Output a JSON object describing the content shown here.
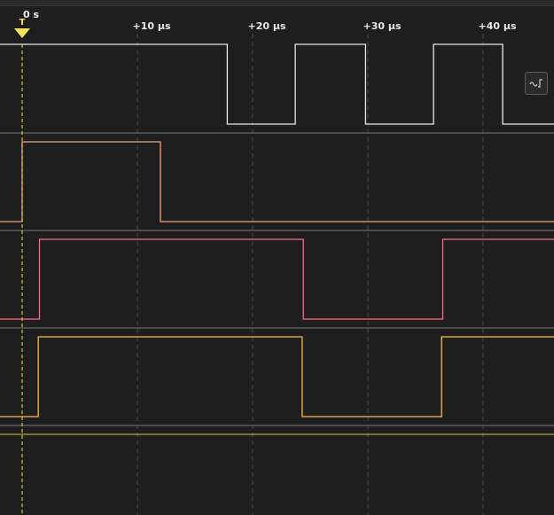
{
  "timeline": {
    "zero_label": "0 s",
    "tick_labels": [
      "+10 µs",
      "+20 µs",
      "+30 µs",
      "+40 µs"
    ],
    "trigger_letter": "T"
  },
  "channels": [
    {
      "color": "#e8e8e8",
      "edges_us": [
        17.8,
        23.7,
        29.8,
        35.7,
        41.7
      ],
      "initial": "high"
    },
    {
      "color": "#f2a07a",
      "edges_us": [
        -0.0,
        12.0
      ],
      "initial": "low"
    },
    {
      "color": "#ff6b86",
      "edges_us": [
        1.5,
        24.4,
        36.5
      ],
      "initial": "low"
    },
    {
      "color": "#ffb84d",
      "edges_us": [
        1.4,
        24.3,
        36.4
      ],
      "initial": "low"
    }
  ],
  "flat_line_color": "#d8cc3a",
  "trigger_color": "#f4e35a",
  "edge_button_icon": "edge-trigger-icon"
}
